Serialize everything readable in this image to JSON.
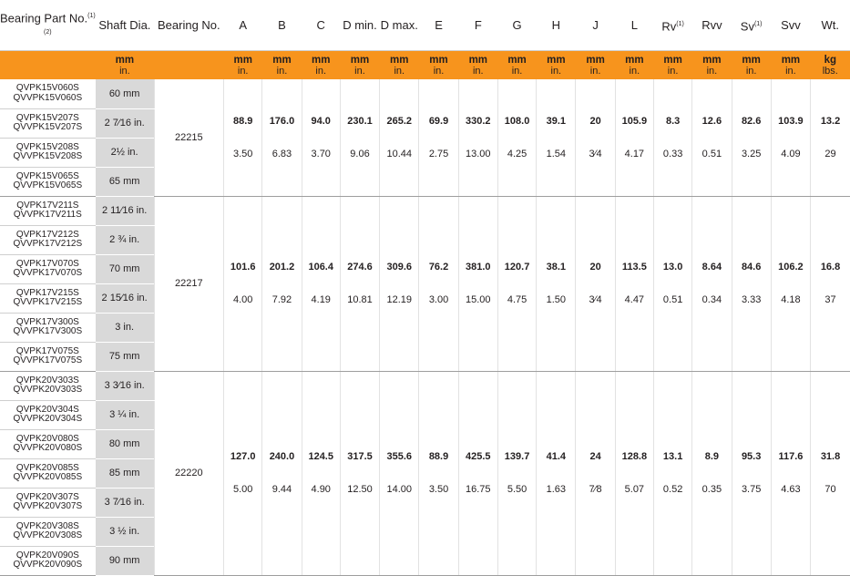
{
  "headers": [
    {
      "key": "part",
      "label": "Bearing Part No.",
      "sup": "(1)(2)"
    },
    {
      "key": "shaft",
      "label": "Shaft Dia.",
      "sup": ""
    },
    {
      "key": "bearing",
      "label": "Bearing No.",
      "sup": ""
    },
    {
      "key": "A",
      "label": "A",
      "sup": ""
    },
    {
      "key": "B",
      "label": "B",
      "sup": ""
    },
    {
      "key": "C",
      "label": "C",
      "sup": ""
    },
    {
      "key": "Dmin",
      "label": "D min.",
      "sup": ""
    },
    {
      "key": "Dmax",
      "label": "D max.",
      "sup": ""
    },
    {
      "key": "E",
      "label": "E",
      "sup": ""
    },
    {
      "key": "F",
      "label": "F",
      "sup": ""
    },
    {
      "key": "G",
      "label": "G",
      "sup": ""
    },
    {
      "key": "H",
      "label": "H",
      "sup": ""
    },
    {
      "key": "J",
      "label": "J",
      "sup": ""
    },
    {
      "key": "L",
      "label": "L",
      "sup": ""
    },
    {
      "key": "Rv",
      "label": "Rv",
      "sup": "(1)"
    },
    {
      "key": "Rvv",
      "label": "Rvv",
      "sup": ""
    },
    {
      "key": "Sv",
      "label": "Sv",
      "sup": "(1)"
    },
    {
      "key": "Svv",
      "label": "Svv",
      "sup": ""
    },
    {
      "key": "Wt",
      "label": "Wt.",
      "sup": ""
    }
  ],
  "units": {
    "shaft": [
      "mm",
      "in."
    ],
    "dims": [
      "mm",
      "in."
    ],
    "wt": [
      "kg",
      "lbs."
    ]
  },
  "groups": [
    {
      "bearing_no": "22215",
      "rows": [
        {
          "parts": [
            "QVPK15V060S",
            "QVVPK15V060S"
          ],
          "shaft": "60 mm",
          "bold": true
        },
        {
          "parts": [
            "QVPK15V207S",
            "QVVPK15V207S"
          ],
          "shaft": "2 7⁄16 in.",
          "bold": false
        },
        {
          "parts": [
            "QVPK15V208S",
            "QVVPK15V208S"
          ],
          "shaft": "2½ in.",
          "bold": false
        },
        {
          "parts": [
            "QVPK15V065S",
            "QVVPK15V065S"
          ],
          "shaft": "65 mm",
          "bold": true
        }
      ],
      "mm": [
        "88.9",
        "176.0",
        "94.0",
        "230.1",
        "265.2",
        "69.9",
        "330.2",
        "108.0",
        "39.1",
        "20",
        "105.9",
        "8.3",
        "12.6",
        "82.6",
        "103.9",
        "13.2"
      ],
      "in": [
        "3.50",
        "6.83",
        "3.70",
        "9.06",
        "10.44",
        "2.75",
        "13.00",
        "4.25",
        "1.54",
        "3⁄4",
        "4.17",
        "0.33",
        "0.51",
        "3.25",
        "4.09",
        "29"
      ]
    },
    {
      "bearing_no": "22217",
      "rows": [
        {
          "parts": [
            "QVPK17V211S",
            "QVVPK17V211S"
          ],
          "shaft": "2 11⁄16 in.",
          "bold": false
        },
        {
          "parts": [
            "QVPK17V212S",
            "QVVPK17V212S"
          ],
          "shaft": "2 ¾ in.",
          "bold": false
        },
        {
          "parts": [
            "QVPK17V070S",
            "QVVPK17V070S"
          ],
          "shaft": "70 mm",
          "bold": true
        },
        {
          "parts": [
            "QVPK17V215S",
            "QVVPK17V215S"
          ],
          "shaft": "2 15⁄16 in.",
          "bold": false
        },
        {
          "parts": [
            "QVPK17V300S",
            "QVVPK17V300S"
          ],
          "shaft": "3 in.",
          "bold": false
        },
        {
          "parts": [
            "QVPK17V075S",
            "QVVPK17V075S"
          ],
          "shaft": "75 mm",
          "bold": true
        }
      ],
      "mm": [
        "101.6",
        "201.2",
        "106.4",
        "274.6",
        "309.6",
        "76.2",
        "381.0",
        "120.7",
        "38.1",
        "20",
        "113.5",
        "13.0",
        "8.64",
        "84.6",
        "106.2",
        "16.8"
      ],
      "in": [
        "4.00",
        "7.92",
        "4.19",
        "10.81",
        "12.19",
        "3.00",
        "15.00",
        "4.75",
        "1.50",
        "3⁄4",
        "4.47",
        "0.51",
        "0.34",
        "3.33",
        "4.18",
        "37"
      ]
    },
    {
      "bearing_no": "22220",
      "rows": [
        {
          "parts": [
            "QVPK20V303S",
            "QVVPK20V303S"
          ],
          "shaft": "3 3⁄16 in.",
          "bold": false
        },
        {
          "parts": [
            "QVPK20V304S",
            "QVVPK20V304S"
          ],
          "shaft": "3 ¼ in.",
          "bold": false
        },
        {
          "parts": [
            "QVPK20V080S",
            "QVVPK20V080S"
          ],
          "shaft": "80 mm",
          "bold": true
        },
        {
          "parts": [
            "QVPK20V085S",
            "QVVPK20V085S"
          ],
          "shaft": "85 mm",
          "bold": true
        },
        {
          "parts": [
            "QVPK20V307S",
            "QVVPK20V307S"
          ],
          "shaft": "3 7⁄16 in.",
          "bold": false
        },
        {
          "parts": [
            "QVPK20V308S",
            "QVVPK20V308S"
          ],
          "shaft": "3 ½ in.",
          "bold": false
        },
        {
          "parts": [
            "QVPK20V090S",
            "QVVPK20V090S"
          ],
          "shaft": "90 mm",
          "bold": true
        }
      ],
      "mm": [
        "127.0",
        "240.0",
        "124.5",
        "317.5",
        "355.6",
        "88.9",
        "425.5",
        "139.7",
        "41.4",
        "24",
        "128.8",
        "13.1",
        "8.9",
        "95.3",
        "117.6",
        "31.8"
      ],
      "in": [
        "5.00",
        "9.44",
        "4.90",
        "12.50",
        "14.00",
        "3.50",
        "16.75",
        "5.50",
        "1.63",
        "7⁄8",
        "5.07",
        "0.52",
        "0.35",
        "3.75",
        "4.63",
        "70"
      ]
    }
  ]
}
